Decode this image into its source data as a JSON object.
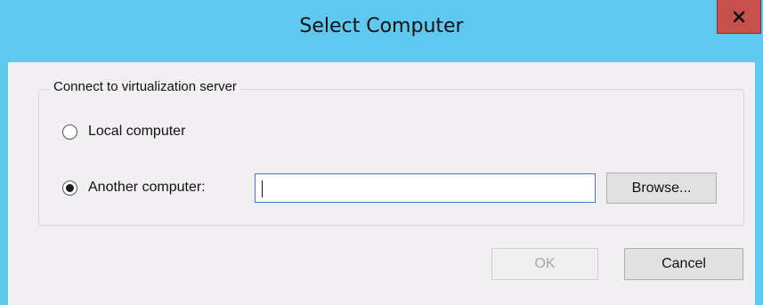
{
  "window": {
    "title": "Select Computer",
    "close_glyph": "x"
  },
  "group": {
    "legend": "Connect to virtualization server"
  },
  "options": {
    "local_label": "Local computer",
    "another_label": "Another computer:",
    "selected": "another"
  },
  "input": {
    "value": ""
  },
  "buttons": {
    "browse": "Browse...",
    "ok": "OK",
    "cancel": "Cancel"
  },
  "colors": {
    "titlebar": "#5ec8ee",
    "close_button": "#c7504b",
    "content_bg": "#f2eff2",
    "input_focus_border": "#3a7bd5"
  },
  "icons": {
    "close": "close-icon"
  }
}
